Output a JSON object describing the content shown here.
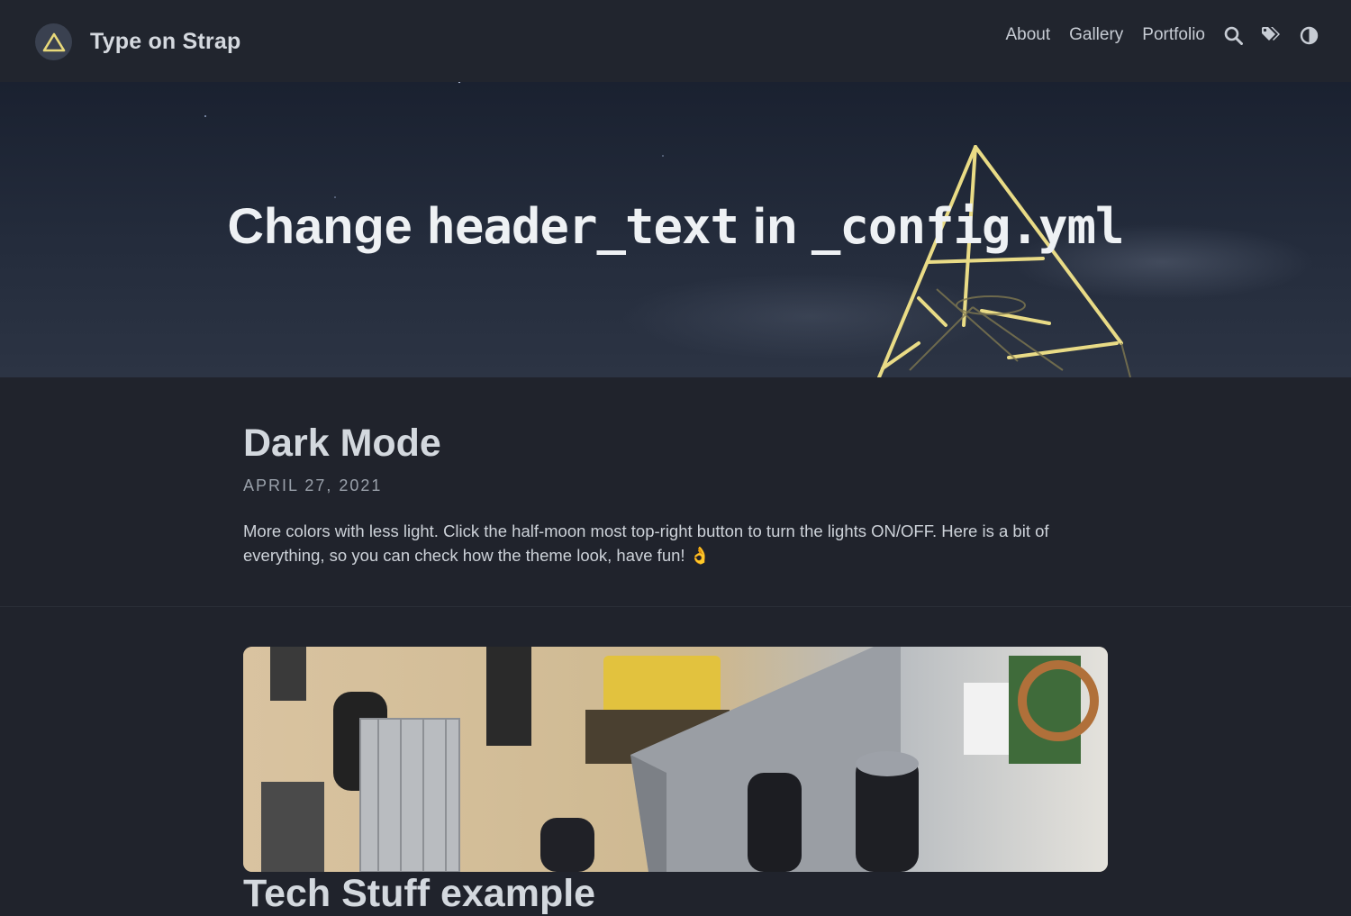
{
  "site": {
    "title": "Type on Strap",
    "logo_icon": "triangle-logo-icon"
  },
  "nav": {
    "links": [
      {
        "label": "About"
      },
      {
        "label": "Gallery"
      },
      {
        "label": "Portfolio"
      }
    ],
    "icons": [
      "search-icon",
      "tags-icon",
      "theme-toggle-icon"
    ]
  },
  "hero": {
    "text_plain_1": "Change",
    "text_code_1": "header_text",
    "text_plain_2": "in",
    "text_code_2": "_config.yml"
  },
  "posts": [
    {
      "title": "Dark Mode",
      "date": "APRIL 27, 2021",
      "excerpt": "More colors with less light. Click the half-moon most top-right button to turn the lights ON/OFF. Here is a bit of everything, so you can check how the theme look, have fun! 👌"
    },
    {
      "title": "Tech Stuff example",
      "image": "circuit-board-photo"
    }
  ],
  "colors": {
    "background": "#20232c",
    "navbar": "#21252e",
    "logo_accent": "#e8d97a",
    "text": "#c9cdd4"
  }
}
